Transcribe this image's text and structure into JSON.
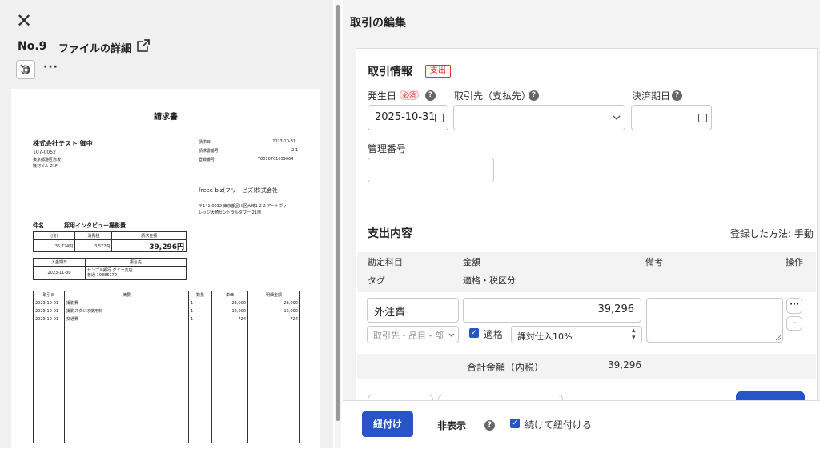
{
  "left": {
    "file_no": "No.9",
    "file_detail": "ファイルの詳細",
    "more": "···"
  },
  "invoice": {
    "title": "請求書",
    "customer": "株式会社テスト 御中",
    "postal": "107-0052",
    "address1": "東京都港区赤坂",
    "address2": "機材ビル 21F",
    "meta": [
      {
        "label": "請求日",
        "value": "2023-10-31"
      },
      {
        "label": "請求書番号",
        "value": "2-1"
      },
      {
        "label": "登録番号",
        "value": "T8010701039064"
      }
    ],
    "issuer": "freee biz(フリービズ)株式会社",
    "issuer_addr1": "〒141-0032 東京都品川区大崎1-2-2 アートヴィ",
    "issuer_addr2": "レッジ大崎セントラルタワー 21階",
    "subject_label": "件名",
    "subject": "採用インタビュー撮影費",
    "sum_headers": [
      "小計",
      "消費税",
      "請求金額"
    ],
    "sum_values": [
      "35,724円",
      "3,572円",
      "39,296円"
    ],
    "pay_headers": [
      "入金期日",
      "振込先"
    ],
    "pay_date": "2023-11-30",
    "bank1": "サンプル銀行  ダミー支店",
    "bank2": "普通  10385170",
    "line_headers": [
      "取引日",
      "摘要",
      "数量",
      "単価",
      "明細金額"
    ],
    "lines": [
      [
        "2023-10-01",
        "撮影費",
        "1",
        "23,000",
        "23,000"
      ],
      [
        "2023-10-01",
        "撮影スタジオ使用料",
        "1",
        "12,000",
        "12,000"
      ],
      [
        "2023-10-01",
        "交通費",
        "1",
        "724",
        "724"
      ]
    ]
  },
  "right": {
    "pane_title": "取引の編集",
    "info_title": "取引情報",
    "type_badge": "支出",
    "date_label": "発生日",
    "required": "必須",
    "partner_label": "取引先（支払先）",
    "due_label": "決済期日",
    "date_value": "2025-10-31",
    "mgmt_label": "管理番号",
    "expense_title": "支出内容",
    "reg_method": "登録した方法: 手動",
    "col_account": "勘定科目",
    "col_amount": "金額",
    "col_note": "備考",
    "col_ops": "操作",
    "col_tag": "タグ",
    "col_tax": "適格・税区分",
    "account_value": "外注費",
    "amount_value": "39,296",
    "tag_placeholder": "取引先・品目・部門",
    "qualified_label": "適格",
    "tax_value": "課対仕入10%",
    "total_label": "合計金額（内税）",
    "total_value": "39,296"
  },
  "bottom": {
    "link_button": "紐付け",
    "hide_button": "非表示",
    "continue_label": "続けて紐付ける"
  }
}
